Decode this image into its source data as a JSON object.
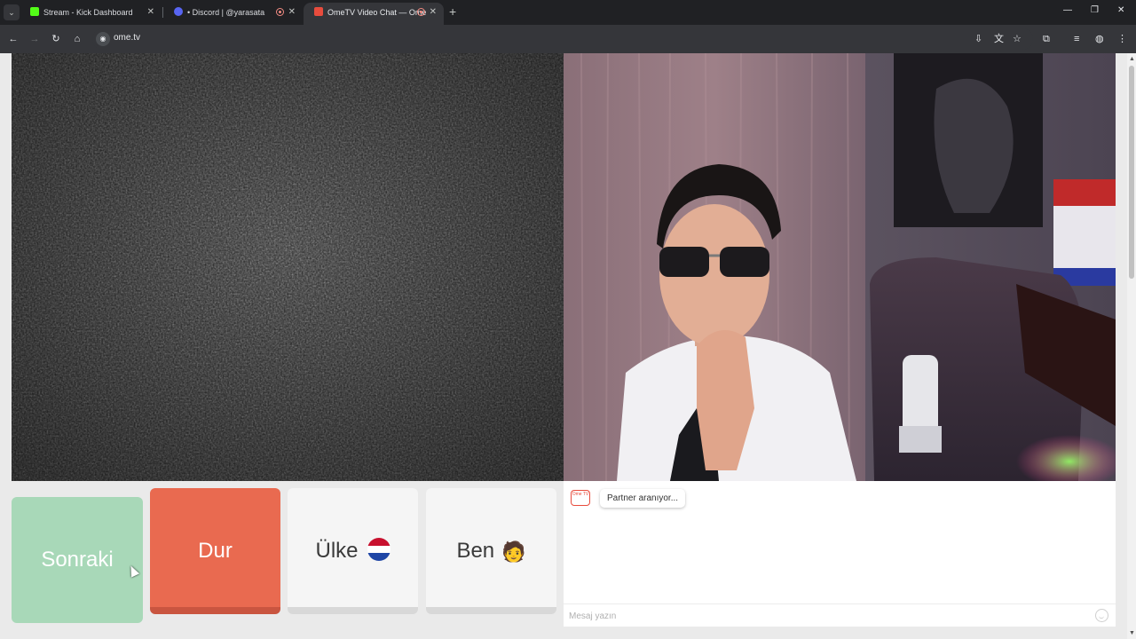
{
  "browser": {
    "tabs": [
      {
        "title": "Stream - Kick Dashboard",
        "favicon": "kick-icon",
        "color": "#53fc18"
      },
      {
        "title": "• Discord | @yarasata",
        "favicon": "discord-icon",
        "color": "#5865f2"
      },
      {
        "title": "OmeTV Video Chat — Ome",
        "favicon": "ometv-icon",
        "color": "#e84c3d",
        "active": true
      }
    ],
    "address": "ome.tv"
  },
  "controls": {
    "next_label": "Sonraki",
    "stop_label": "Dur",
    "country_label": "Ülke",
    "me_label": "Ben",
    "me_emoji": "🧑"
  },
  "chat": {
    "logo_text": "Ome TV",
    "status": "Partner aranıyor...",
    "input_placeholder": "Mesaj yazın"
  },
  "colors": {
    "next": "#a8d8b8",
    "stop": "#e96a50",
    "flag": [
      "#c8102e",
      "#ffffff",
      "#1f46a6"
    ]
  }
}
